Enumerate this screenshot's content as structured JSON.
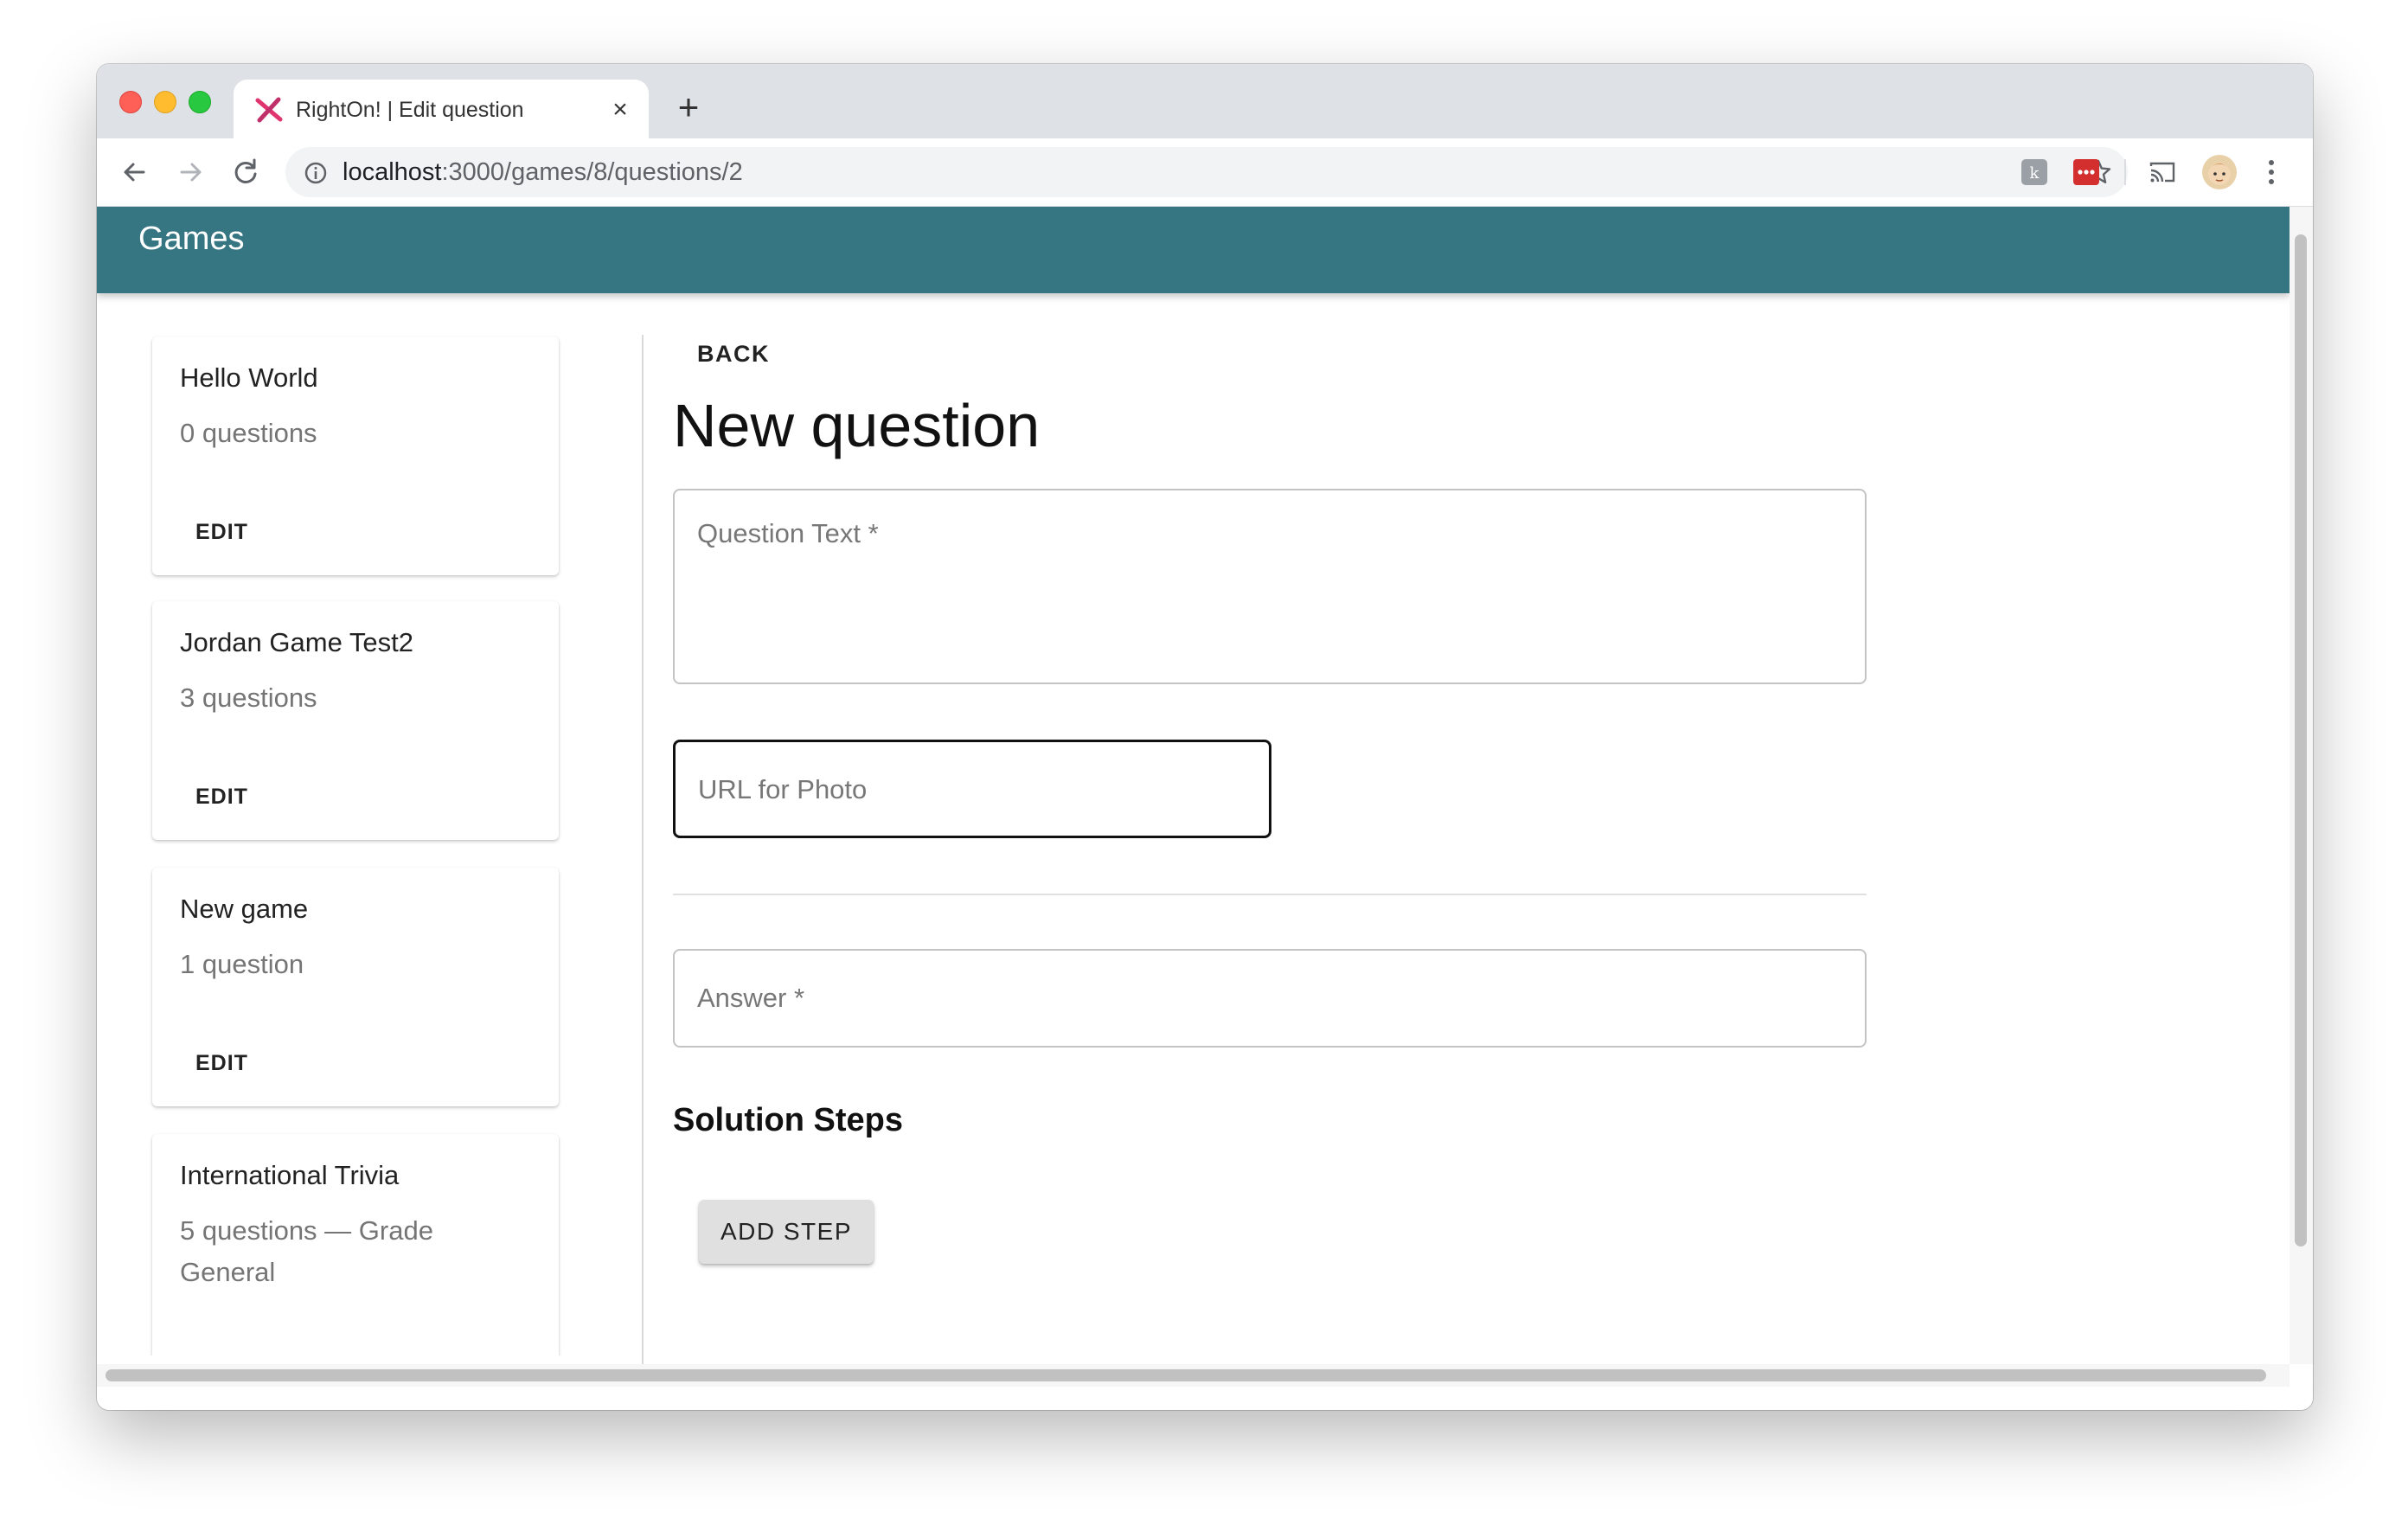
{
  "browser": {
    "tab_title": "RightOn! | Edit question",
    "tab_close_icon": "close-icon",
    "new_tab_icon": "plus-icon",
    "url_host": "localhost",
    "url_path": ":3000/games/8/questions/2",
    "icons": [
      "back-arrow-icon",
      "forward-arrow-icon",
      "reload-icon",
      "info-icon",
      "star-icon",
      "extension-icon",
      "password-manager-icon",
      "cast-icon",
      "avatar",
      "more-vert-icon"
    ]
  },
  "app": {
    "header_title": "Games",
    "header_color": "#357682"
  },
  "sidebar": {
    "cards": [
      {
        "title": "Hello World",
        "subtitle": "0 questions",
        "action": "EDIT"
      },
      {
        "title": "Jordan Game Test2",
        "subtitle": "3 questions",
        "action": "EDIT"
      },
      {
        "title": "New game",
        "subtitle": "1 question",
        "action": "EDIT"
      },
      {
        "title": "International Trivia",
        "subtitle": "5 questions — Grade General",
        "action": ""
      }
    ]
  },
  "main": {
    "back_label": "BACK",
    "page_title": "New question",
    "question_text_label": "Question Text *",
    "photo_url_label": "URL for Photo",
    "answer_label": "Answer *",
    "solution_steps_title": "Solution Steps",
    "add_step_label": "ADD STEP"
  }
}
